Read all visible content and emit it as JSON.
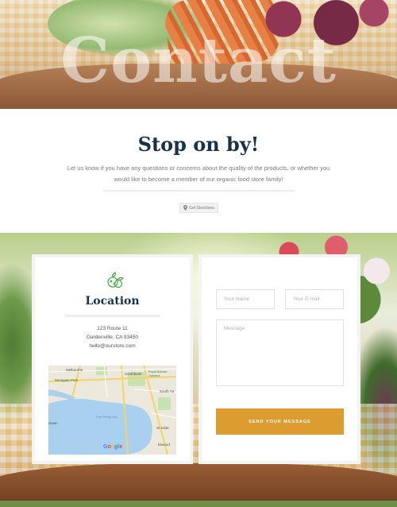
{
  "hero": {
    "title": "Contact"
  },
  "intro": {
    "heading": "Stop on by!",
    "description": "Let us know if you have any questions or concerns about the quality of the products, or whether you would like to become a member of our organic food store family!",
    "directions_label": "Get Directions"
  },
  "location": {
    "title": "Location",
    "address_line1": "123 Route 11",
    "address_line2": "Gardenville, CA 93450",
    "email": "hello@ourstore.com",
    "map": {
      "labels": [
        "Melbourne",
        "Westgate Park",
        "Southbank",
        "Royal Botanic Gardens",
        "Port Phillip Bay",
        "South Ya",
        "St Kilda",
        "Elwood",
        "Williamstown",
        "Google"
      ]
    }
  },
  "form": {
    "name_placeholder": "Your Name",
    "email_placeholder": "Your E-mail",
    "message_placeholder": "Message",
    "submit_label": "SEND YOUR MESSAGE"
  },
  "colors": {
    "heading": "#17324a",
    "accent": "#dd9c2f",
    "icon_green": "#4caf50"
  },
  "icons": [
    "map-pin-icon",
    "vegetables-icon"
  ]
}
